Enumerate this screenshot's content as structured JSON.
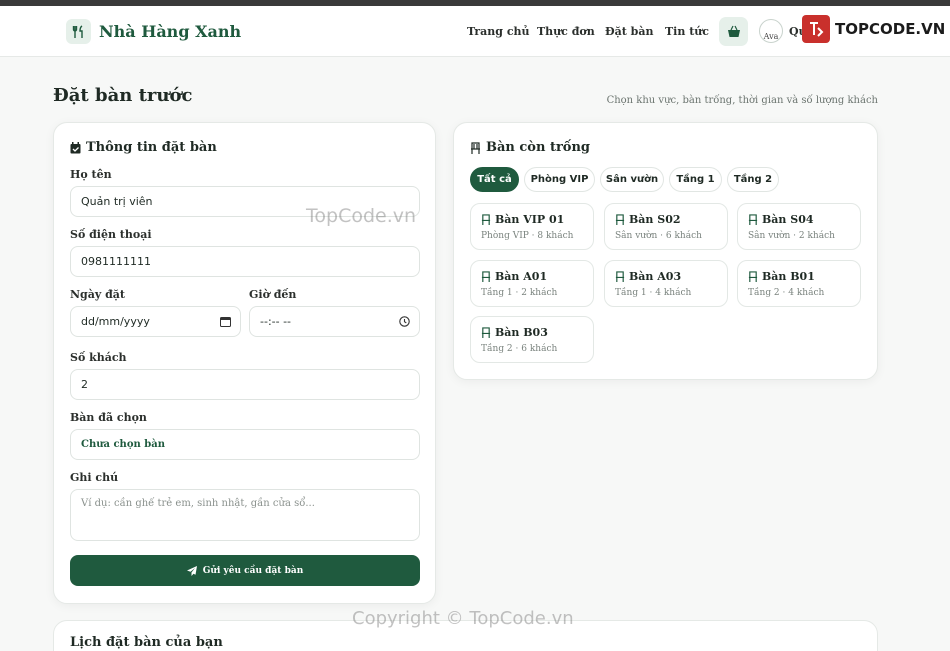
{
  "header": {
    "brand": "Nhà Hàng Xanh",
    "nav": [
      "Trang chủ",
      "Thực đơn",
      "Đặt bàn",
      "Tin tức"
    ],
    "avatar_alt": "Ava",
    "user_name": "Qu",
    "logo_text": "TOPCODE.VN"
  },
  "page": {
    "title": "Đặt bàn trước",
    "subtitle": "Chọn khu vực, bàn trống, thời gian và số lượng khách"
  },
  "form": {
    "title": "Thông tin đặt bàn",
    "name_label": "Họ tên",
    "name_value": "Quản trị viên",
    "phone_label": "Số điện thoại",
    "phone_value": "0981111111",
    "date_label": "Ngày đặt",
    "date_placeholder": "dd/mm/yyyy",
    "time_label": "Giờ đến",
    "time_placeholder": "--:-- --",
    "guests_label": "Số khách",
    "guests_value": "2",
    "table_label": "Bàn đã chọn",
    "table_value": "Chưa chọn bàn",
    "note_label": "Ghi chú",
    "note_placeholder": "Ví dụ: cần ghế trẻ em, sinh nhật, gần cửa sổ...",
    "submit_label": "Gửi yêu cầu đặt bàn"
  },
  "tables": {
    "title": "Bàn còn trống",
    "filters": [
      "Tất cả",
      "Phòng VIP",
      "Sân vườn",
      "Tầng 1",
      "Tầng 2"
    ],
    "active_filter": "Tất cả",
    "items": [
      {
        "name": "Bàn VIP 01",
        "meta": "Phòng VIP · 8 khách"
      },
      {
        "name": "Bàn S02",
        "meta": "Sân vườn · 6 khách"
      },
      {
        "name": "Bàn S04",
        "meta": "Sân vườn · 2 khách"
      },
      {
        "name": "Bàn A01",
        "meta": "Tầng 1 · 2 khách"
      },
      {
        "name": "Bàn A03",
        "meta": "Tầng 1 · 4 khách"
      },
      {
        "name": "Bàn B01",
        "meta": "Tầng 2 · 4 khách"
      },
      {
        "name": "Bàn B03",
        "meta": "Tầng 2 · 6 khách"
      }
    ]
  },
  "history": {
    "title": "Lịch đặt bàn của bạn"
  },
  "watermarks": {
    "center": "TopCode.vn",
    "footer": "Copyright © TopCode.vn"
  },
  "colors": {
    "primary": "#1f5a3e",
    "accent_light": "#e6f0ea",
    "background": "#f7f8f7"
  }
}
